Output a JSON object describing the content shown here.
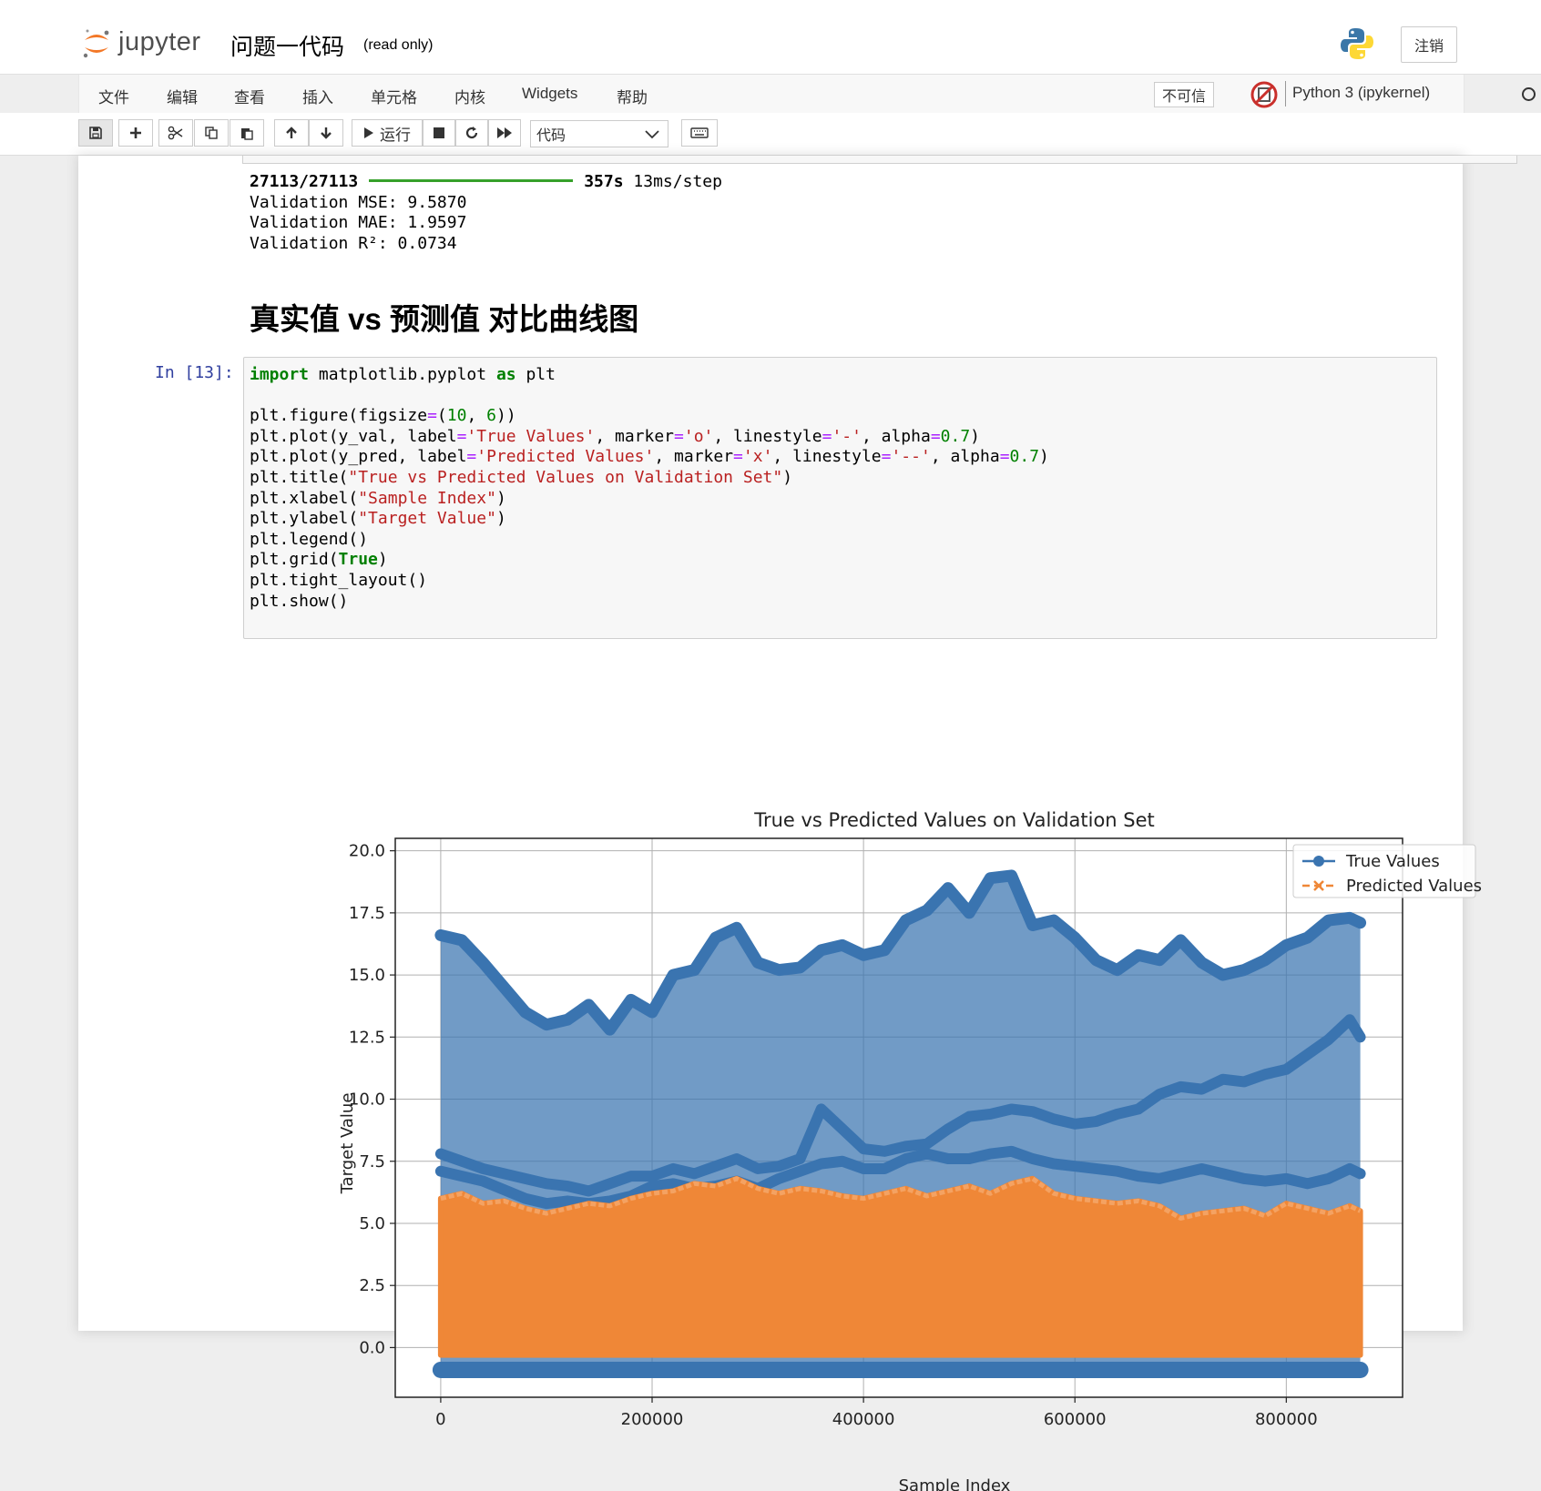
{
  "header": {
    "logo_text": "jupyter",
    "notebook_title": "问题一代码",
    "read_only": "(read only)",
    "logout_label": "注销"
  },
  "menubar": {
    "items": [
      "文件",
      "编辑",
      "查看",
      "插入",
      "单元格",
      "内核",
      "Widgets",
      "帮助"
    ],
    "trust_label": "不可信",
    "kernel_name": "Python 3 (ipykernel)"
  },
  "toolbar": {
    "run_label": "运行",
    "cell_type": "代码"
  },
  "output": {
    "progress_count": "27113/27113",
    "progress_time": "357s",
    "progress_rate": "13ms/step",
    "mse": "Validation MSE: 9.5870",
    "mae": "Validation MAE: 1.9597",
    "r2": "Validation R²: 0.0734"
  },
  "section_heading": "真实值 vs 预测值 对比曲线图",
  "cell": {
    "prompt": "In [13]:"
  },
  "colors": {
    "true_series": "#3a74b0",
    "pred_series": "#ef8737",
    "progress": "#36a12a"
  },
  "chart_data": {
    "type": "line",
    "title": "True vs Predicted Values on Validation Set",
    "xlabel": "Sample Index",
    "ylabel": "Target Value",
    "xlim": [
      -43000,
      910000
    ],
    "ylim": [
      -2,
      20.5
    ],
    "xticks": [
      0,
      200000,
      400000,
      600000,
      800000
    ],
    "yticks": [
      0.0,
      2.5,
      5.0,
      7.5,
      10.0,
      12.5,
      15.0,
      17.5,
      20.0
    ],
    "grid": true,
    "legend_position": "top-right",
    "series": [
      {
        "name": "True Values",
        "marker": "o",
        "linestyle": "-",
        "upper_envelope": {
          "x": [
            0,
            20000,
            40000,
            60000,
            80000,
            100000,
            120000,
            140000,
            160000,
            180000,
            200000,
            220000,
            240000,
            260000,
            280000,
            300000,
            320000,
            340000,
            360000,
            380000,
            400000,
            420000,
            440000,
            460000,
            480000,
            500000,
            520000,
            540000,
            560000,
            580000,
            600000,
            620000,
            640000,
            660000,
            680000,
            700000,
            720000,
            740000,
            760000,
            780000,
            800000,
            820000,
            840000,
            860000,
            870000
          ],
          "y": [
            16.6,
            16.4,
            15.5,
            14.5,
            13.5,
            13.0,
            13.2,
            13.8,
            12.8,
            14.0,
            13.5,
            15.0,
            15.2,
            16.5,
            16.9,
            15.5,
            15.2,
            15.3,
            16.0,
            16.2,
            15.8,
            16.0,
            17.2,
            17.6,
            18.5,
            17.5,
            18.9,
            19.0,
            17.0,
            17.2,
            16.5,
            15.6,
            15.2,
            15.8,
            15.6,
            16.4,
            15.5,
            15.0,
            15.2,
            15.6,
            16.2,
            16.5,
            17.2,
            17.3,
            17.1
          ]
        },
        "lower_bound": -0.9,
        "band_upper": {
          "x": [
            0,
            40000,
            80000,
            100000,
            120000,
            140000,
            160000,
            180000,
            200000,
            220000,
            240000,
            260000,
            280000,
            300000,
            320000,
            340000,
            360000,
            380000,
            400000,
            420000,
            440000,
            460000,
            480000,
            500000,
            520000,
            540000,
            560000,
            580000,
            600000,
            620000,
            640000,
            660000,
            680000,
            700000,
            720000,
            740000,
            760000,
            780000,
            800000,
            820000,
            840000,
            860000,
            870000
          ],
          "y": [
            7.8,
            7.2,
            6.8,
            6.6,
            6.5,
            6.3,
            6.6,
            6.9,
            6.9,
            7.2,
            7.0,
            7.3,
            7.6,
            7.2,
            7.3,
            7.6,
            9.6,
            8.8,
            8.0,
            7.9,
            8.1,
            8.2,
            8.8,
            9.3,
            9.4,
            9.6,
            9.5,
            9.2,
            9.0,
            9.1,
            9.4,
            9.6,
            10.2,
            10.5,
            10.4,
            10.8,
            10.7,
            11.0,
            11.2,
            11.8,
            12.4,
            13.2,
            12.5
          ]
        },
        "band_lower": {
          "x": [
            0,
            40000,
            80000,
            100000,
            120000,
            140000,
            160000,
            180000,
            200000,
            220000,
            240000,
            260000,
            280000,
            300000,
            320000,
            340000,
            360000,
            380000,
            400000,
            420000,
            440000,
            460000,
            480000,
            500000,
            520000,
            540000,
            560000,
            580000,
            600000,
            620000,
            640000,
            660000,
            680000,
            700000,
            720000,
            740000,
            760000,
            780000,
            800000,
            820000,
            840000,
            860000,
            870000
          ],
          "y": [
            7.1,
            6.7,
            6.0,
            5.8,
            5.9,
            5.8,
            5.9,
            6.1,
            6.5,
            6.6,
            6.4,
            6.5,
            6.7,
            6.4,
            6.8,
            7.1,
            7.4,
            7.5,
            7.2,
            7.2,
            7.6,
            7.8,
            7.6,
            7.6,
            7.8,
            7.9,
            7.6,
            7.4,
            7.3,
            7.2,
            7.1,
            6.9,
            6.8,
            7.0,
            7.2,
            7.0,
            6.8,
            6.7,
            6.8,
            6.6,
            6.8,
            7.2,
            7.0
          ]
        }
      },
      {
        "name": "Predicted Values",
        "marker": "x",
        "linestyle": "--",
        "upper_envelope": {
          "x": [
            0,
            20000,
            40000,
            60000,
            80000,
            100000,
            120000,
            140000,
            160000,
            180000,
            200000,
            220000,
            240000,
            260000,
            280000,
            300000,
            320000,
            340000,
            360000,
            380000,
            400000,
            420000,
            440000,
            460000,
            480000,
            500000,
            520000,
            540000,
            560000,
            580000,
            600000,
            620000,
            640000,
            660000,
            680000,
            700000,
            720000,
            740000,
            760000,
            780000,
            800000,
            820000,
            840000,
            860000,
            870000
          ],
          "y": [
            6.0,
            6.2,
            5.8,
            5.9,
            5.6,
            5.4,
            5.6,
            5.8,
            5.7,
            6.0,
            6.2,
            6.3,
            6.6,
            6.5,
            6.8,
            6.4,
            6.2,
            6.4,
            6.3,
            6.1,
            6.0,
            6.2,
            6.4,
            6.1,
            6.3,
            6.5,
            6.2,
            6.6,
            6.8,
            6.2,
            6.0,
            5.9,
            5.8,
            5.9,
            5.7,
            5.2,
            5.4,
            5.5,
            5.6,
            5.3,
            5.8,
            5.6,
            5.4,
            5.7,
            5.5
          ]
        },
        "lower_envelope": {
          "x": [
            0,
            870000
          ],
          "y": [
            -0.3,
            -0.3
          ]
        }
      }
    ]
  }
}
